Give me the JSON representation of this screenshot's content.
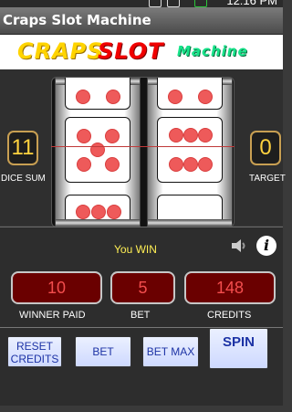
{
  "status": {
    "time": "12:16 PM"
  },
  "app": {
    "title": "Craps Slot Machine"
  },
  "banner": {
    "craps": "CRAPS",
    "slot": "SLOT",
    "machine": "Machine"
  },
  "game": {
    "dice_sum": "11",
    "target": "0",
    "dice_sum_label": "DICE SUM",
    "target_label": "TARGET",
    "win_message": "You WIN",
    "winner_paid": "10",
    "bet": "5",
    "credits": "148",
    "winner_paid_label": "WINNER PAID",
    "bet_label": "BET",
    "credits_label": "CREDITS"
  },
  "buttons": {
    "reset_line1": "RESET",
    "reset_line2": "CREDITS",
    "bet": "BET",
    "bet_max": "BET MAX",
    "spin": "SPIN"
  },
  "icons": {
    "sound": "speaker-icon",
    "info": "info-icon"
  },
  "colors": {
    "dice_pip": "#ee5a5a",
    "counter_bg": "#6a0000",
    "counter_text": "#f34d4d",
    "gold": "#ffd23f"
  }
}
